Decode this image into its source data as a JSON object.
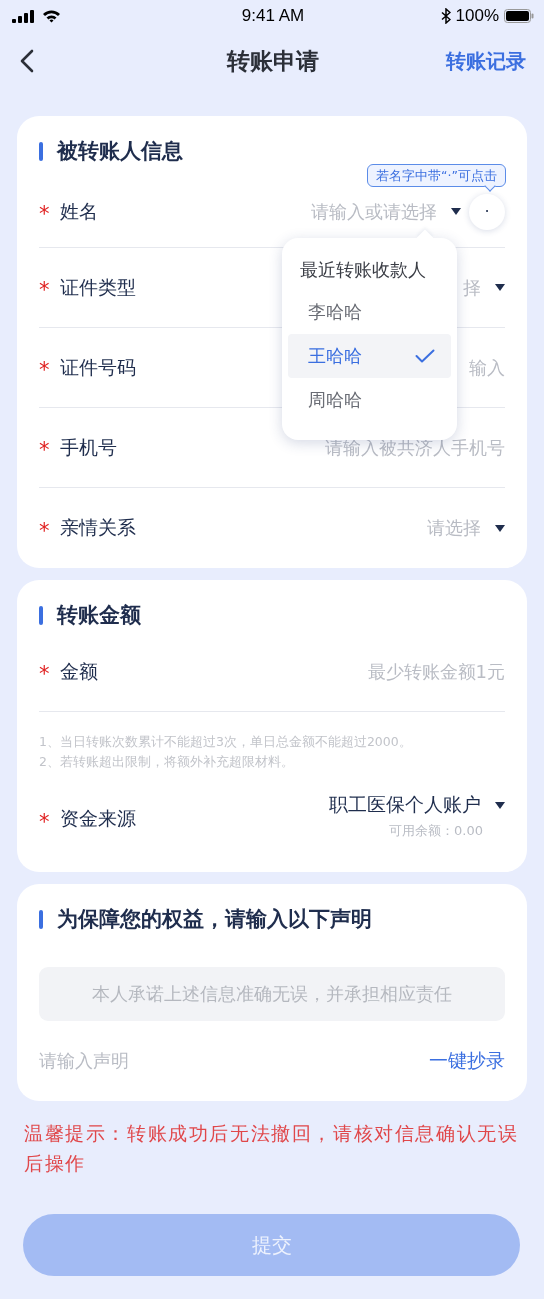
{
  "status_bar": {
    "time": "9:41 AM",
    "battery": "100%"
  },
  "nav": {
    "title": "转账申请",
    "action": "转账记录"
  },
  "recipient_card": {
    "title": "被转账人信息",
    "tooltip": "若名字中带“·”可点击",
    "dot_button": "·",
    "fields": [
      {
        "label": "姓名",
        "required_mark": "*",
        "kind": "select",
        "placeholder": "请输入或请选择"
      },
      {
        "label": "证件类型",
        "required_mark": "*",
        "kind": "select",
        "placeholder": "择"
      },
      {
        "label": "证件号码",
        "required_mark": "*",
        "kind": "input",
        "placeholder": "输入"
      },
      {
        "label": "手机号",
        "required_mark": "*",
        "kind": "input",
        "placeholder": "请输入被共济人手机号"
      },
      {
        "label": "亲情关系",
        "required_mark": "*",
        "kind": "select",
        "placeholder": "请选择"
      }
    ],
    "recent_payees": {
      "title": "最近转账收款人",
      "items": [
        {
          "name": "李哈哈",
          "selected": false
        },
        {
          "name": "王哈哈",
          "selected": true
        },
        {
          "name": "周哈哈",
          "selected": false
        }
      ]
    }
  },
  "amount_card": {
    "title": "转账金额",
    "amount": {
      "label": "金额",
      "required_mark": "*",
      "kind": "input",
      "placeholder": "最少转账金额1元"
    },
    "notes": [
      "1、当日转账次数累计不能超过3次，单日总金额不能超过2000。",
      "2、若转账超出限制，将额外补充超限材料。"
    ],
    "source": {
      "label": "资金来源",
      "required_mark": "*",
      "value": "职工医保个人账户",
      "balance": "可用余额：0.00"
    }
  },
  "statement_card": {
    "title": "为保障您的权益，请输入以下声明",
    "statement": "本人承诺上述信息准确无误，并承担相应责任",
    "input_placeholder": "请输入声明",
    "copy_action": "一键抄录"
  },
  "warning": "温馨提示：转账成功后无法撤回，请核对信息确认无误后操作",
  "submit": {
    "label": "提交",
    "disabled": true
  }
}
